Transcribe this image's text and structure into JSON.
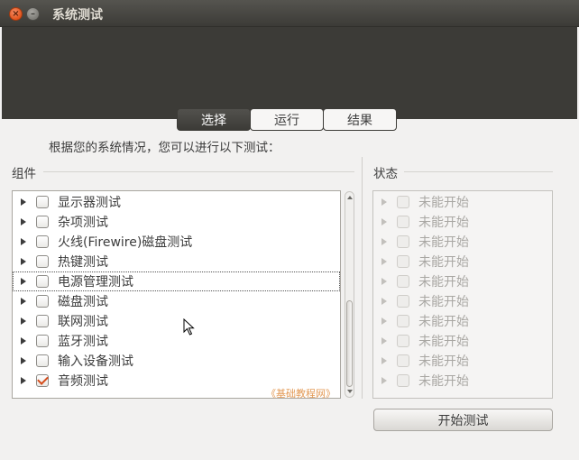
{
  "window": {
    "title": "系统测试"
  },
  "tabs": [
    {
      "label": "选择",
      "active": true
    },
    {
      "label": "运行",
      "active": false
    },
    {
      "label": "结果",
      "active": false
    }
  ],
  "intro": "根据您的系统情况，您可以进行以下测试：",
  "components": {
    "header": "组件",
    "items": [
      {
        "label": "显示器测试",
        "checked": false
      },
      {
        "label": "杂项测试",
        "checked": false
      },
      {
        "label": "火线(Firewire)磁盘测试",
        "checked": false
      },
      {
        "label": "热键测试",
        "checked": false
      },
      {
        "label": "电源管理测试",
        "checked": false,
        "focused": true
      },
      {
        "label": "磁盘测试",
        "checked": false
      },
      {
        "label": "联网测试",
        "checked": false
      },
      {
        "label": "蓝牙测试",
        "checked": false
      },
      {
        "label": "输入设备测试",
        "checked": false
      },
      {
        "label": "音频测试",
        "checked": true
      }
    ]
  },
  "status": {
    "header": "状态",
    "items": [
      "未能开始",
      "未能开始",
      "未能开始",
      "未能开始",
      "未能开始",
      "未能开始",
      "未能开始",
      "未能开始",
      "未能开始",
      "未能开始"
    ]
  },
  "watermark": "《基础教程网》",
  "start_button": "开始测试",
  "colors": {
    "accent": "#d54d1c",
    "dark": "#3c3b37",
    "close": "#e2531b"
  },
  "icons": {
    "close": "close-icon",
    "minimize": "minimize-icon",
    "expander": "triangle-right-icon"
  }
}
